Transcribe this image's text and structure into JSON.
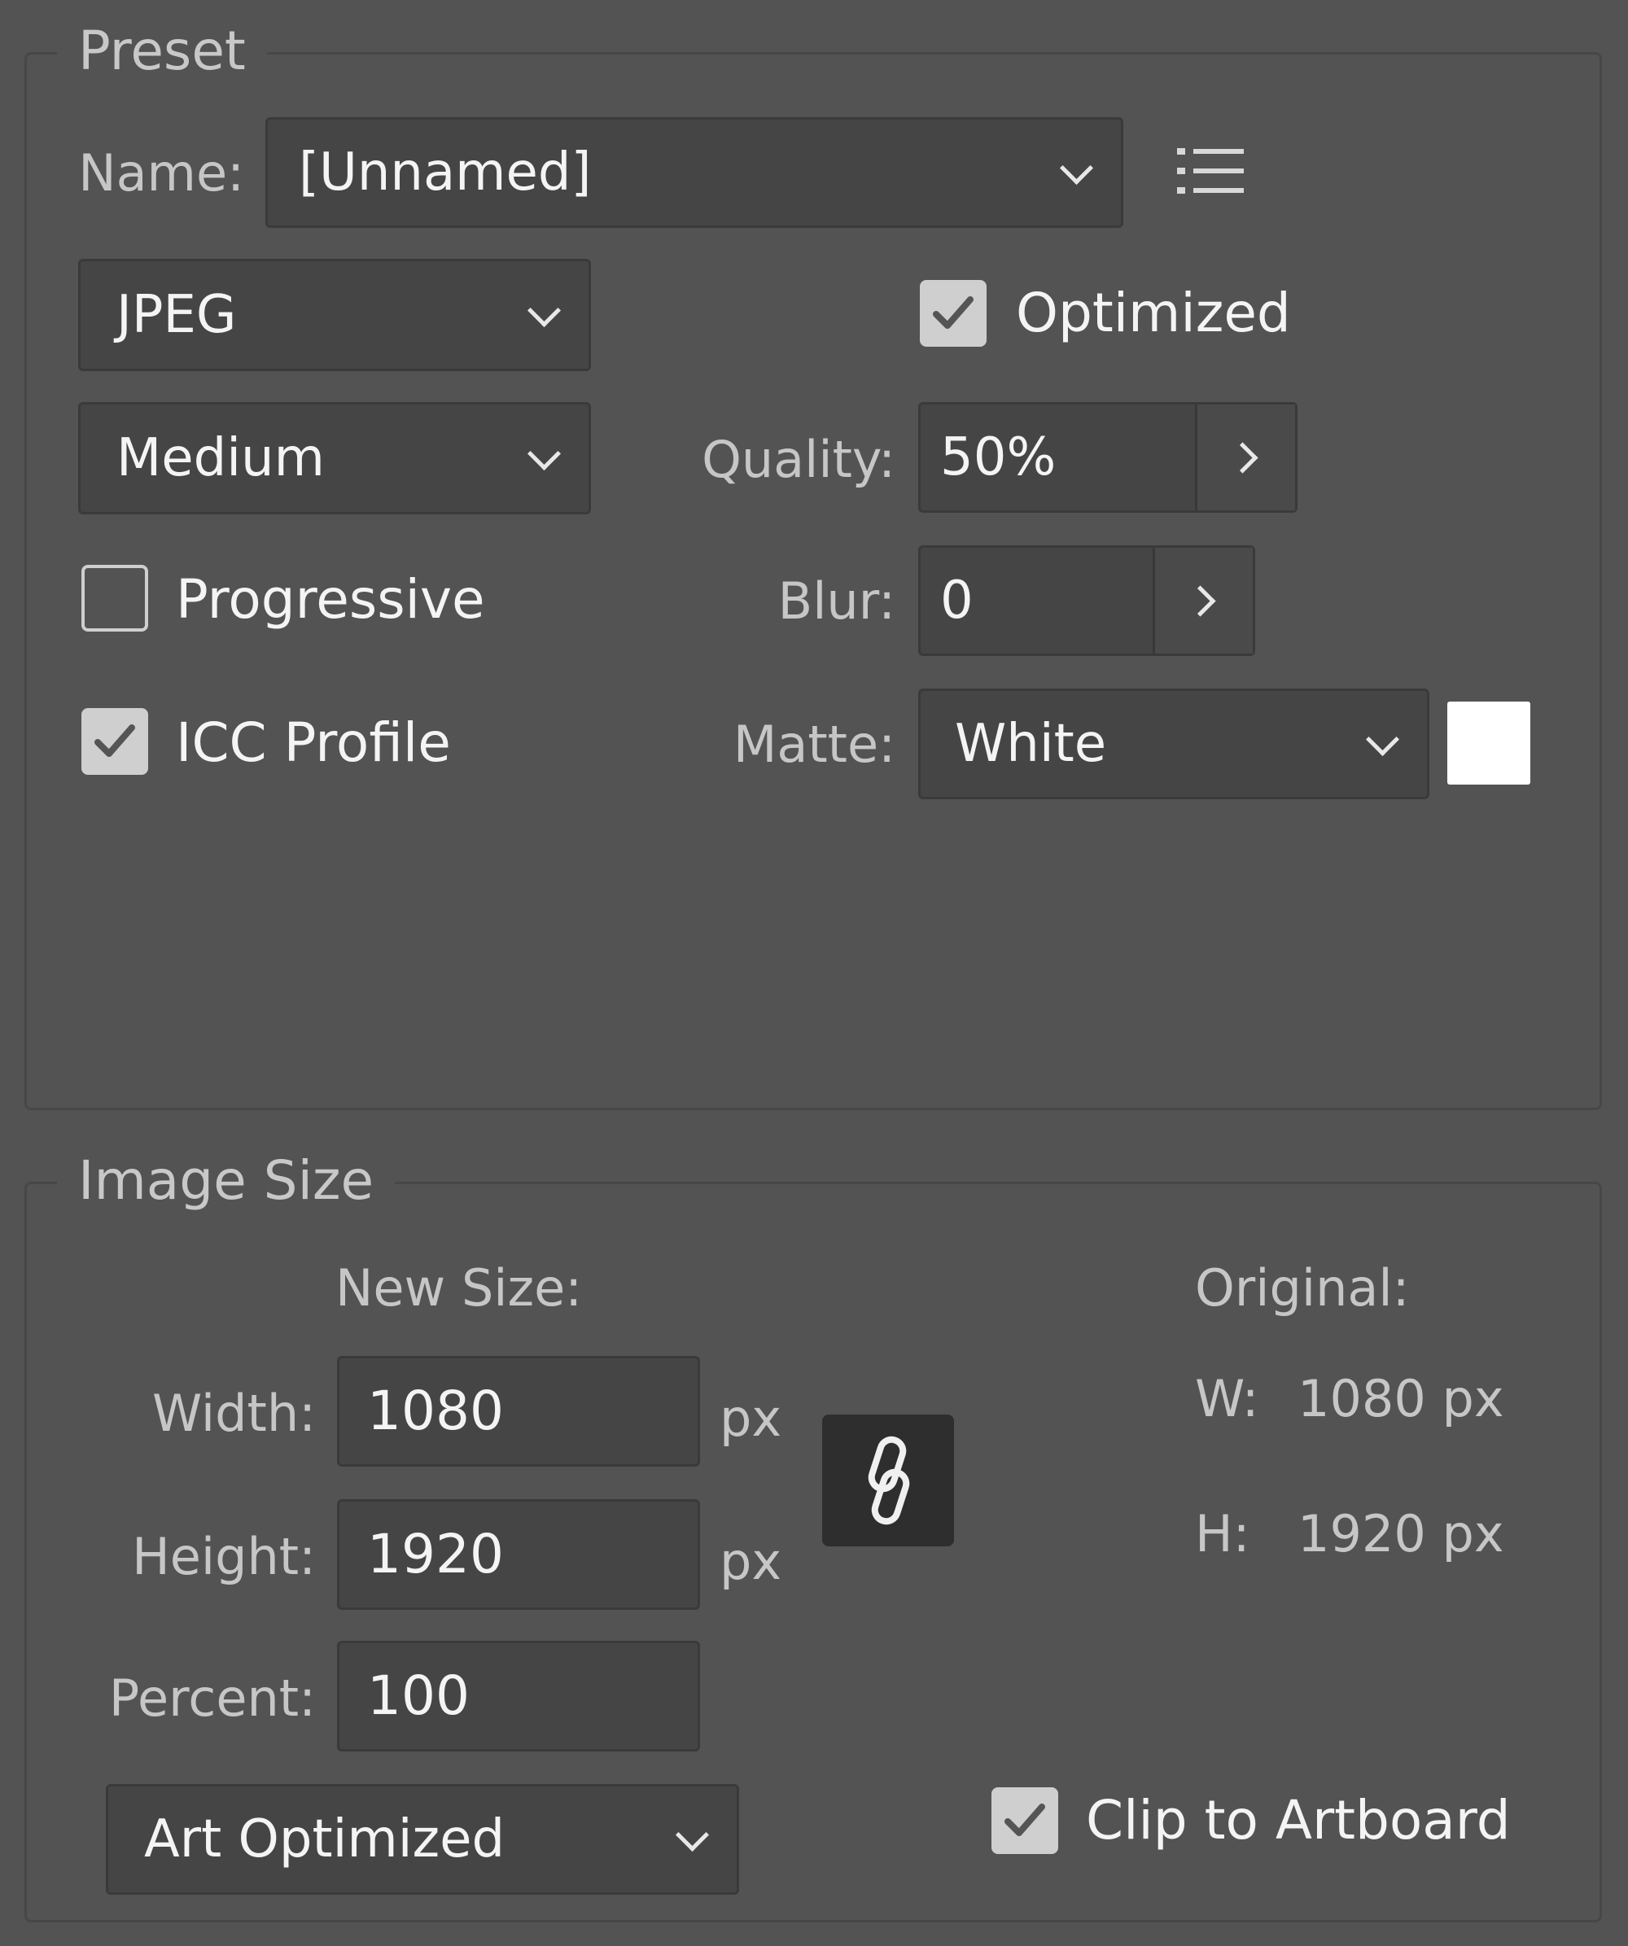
{
  "preset": {
    "legend": "Preset",
    "name_label": "Name:",
    "name_value": "[Unnamed]",
    "format_value": "JPEG",
    "optimized_label": "Optimized",
    "optimized_checked": true,
    "quality_preset_value": "Medium",
    "quality_label": "Quality:",
    "quality_value": "50%",
    "progressive_label": "Progressive",
    "progressive_checked": false,
    "blur_label": "Blur:",
    "blur_value": "0",
    "icc_label": "ICC Profile",
    "icc_checked": true,
    "matte_label": "Matte:",
    "matte_value": "White",
    "matte_color": "#ffffff"
  },
  "image_size": {
    "legend": "Image Size",
    "new_size_label": "New Size:",
    "width_label": "Width:",
    "width_value": "1080",
    "height_label": "Height:",
    "height_value": "1920",
    "percent_label": "Percent:",
    "percent_value": "100",
    "unit": "px",
    "original_label": "Original:",
    "original_w_label": "W:",
    "original_w_value": "1080 px",
    "original_h_label": "H:",
    "original_h_value": "1920 px",
    "resample_value": "Art Optimized",
    "clip_label": "Clip to Artboard",
    "clip_checked": true
  },
  "icons": {
    "preset_menu": "list-menu-icon",
    "constrain": "link-icon",
    "dropdown": "chevron-down-icon",
    "stepper": "chevron-right-icon",
    "check": "checkmark-icon"
  }
}
